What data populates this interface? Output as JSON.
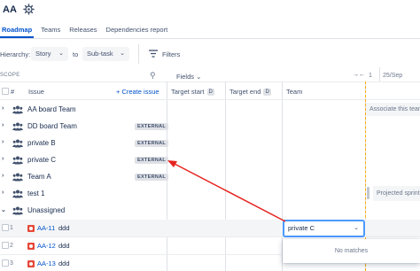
{
  "project": {
    "key": "AA"
  },
  "tabs": [
    {
      "label": "Roadmap",
      "active": true
    },
    {
      "label": "Teams",
      "active": false
    },
    {
      "label": "Releases",
      "active": false
    },
    {
      "label": "Dependencies report",
      "active": false
    }
  ],
  "hierarchy": {
    "label": "Hierarchy:",
    "from": "Story",
    "to_label": "to",
    "to": "Sub-task"
  },
  "filters_label": "Filters",
  "grid": {
    "scope_label": "SCOPE",
    "fields_label": "Fields",
    "month_tick": "1",
    "date_label": "25/Sep",
    "columns": {
      "num": "#",
      "issue": "Issue",
      "create_issue": "+ Create issue",
      "target_start": "Target start",
      "target_end": "Target end",
      "team": "Team",
      "date_badge": "D"
    }
  },
  "rows": [
    {
      "name": "AA board Team",
      "badge": ""
    },
    {
      "name": "DD board Team",
      "badge": "EXTERNAL"
    },
    {
      "name": "private B",
      "badge": "EXTERNAL"
    },
    {
      "name": "private C",
      "badge": "EXTERNAL"
    },
    {
      "name": "Team A",
      "badge": "EXTERNAL"
    },
    {
      "name": "test 1",
      "badge": ""
    },
    {
      "name": "Unassigned",
      "badge": ""
    }
  ],
  "issues": [
    {
      "num": "1",
      "key": "AA-11",
      "summary": "ddd"
    },
    {
      "num": "2",
      "key": "AA-12",
      "summary": "ddd"
    },
    {
      "num": "3",
      "key": "AA-13",
      "summary": "ddd"
    }
  ],
  "team_input": {
    "value": "private C",
    "no_matches": "No matches"
  },
  "timeline": {
    "associate_text": "Associate this team",
    "projected_text": "Projected sprint"
  },
  "colors": {
    "accent": "#0052cc",
    "annotation_arrow": "#e5231f",
    "focus_border": "#4c9aff",
    "issue_icon": "#e5493a"
  }
}
